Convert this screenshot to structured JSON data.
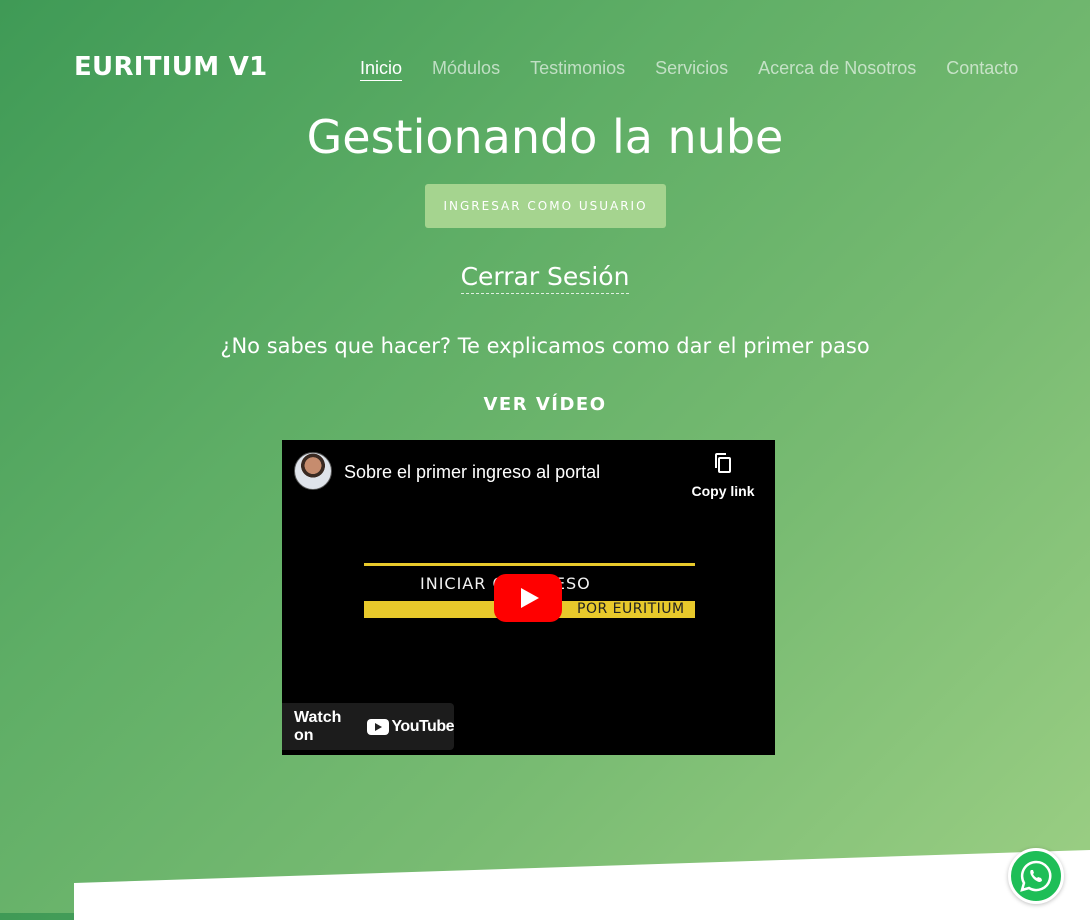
{
  "header": {
    "brand": "EURITIUM V1",
    "nav": [
      {
        "label": "Inicio",
        "active": true
      },
      {
        "label": "Módulos"
      },
      {
        "label": "Testimonios"
      },
      {
        "label": "Servicios"
      },
      {
        "label": "Acerca de Nosotros"
      },
      {
        "label": "Contacto"
      }
    ]
  },
  "hero": {
    "title": "Gestionando la nube",
    "login_button": "INGRESAR COMO USUARIO",
    "logout_link": "Cerrar Sesión",
    "subtitle": "¿No sabes que hacer? Te explicamos como dar el primer paso",
    "video_heading": "VER VÍDEO"
  },
  "video": {
    "title": "Sobre el primer ingreso al portal",
    "copy_link": "Copy link",
    "thumbnail_line1": "INICIAR C    INGRESO",
    "thumbnail_line2": "POR EURITIUM",
    "watch_on": "Watch on",
    "youtube_word": "YouTube"
  },
  "colors": {
    "accent_button": "#a5d48f",
    "play_button": "#ff0000",
    "thumbnail_yellow": "#e8c92b",
    "whatsapp": "#1ebe57"
  },
  "icons": {
    "copy": "copy-icon",
    "play": "play-icon",
    "whatsapp": "whatsapp-icon"
  }
}
